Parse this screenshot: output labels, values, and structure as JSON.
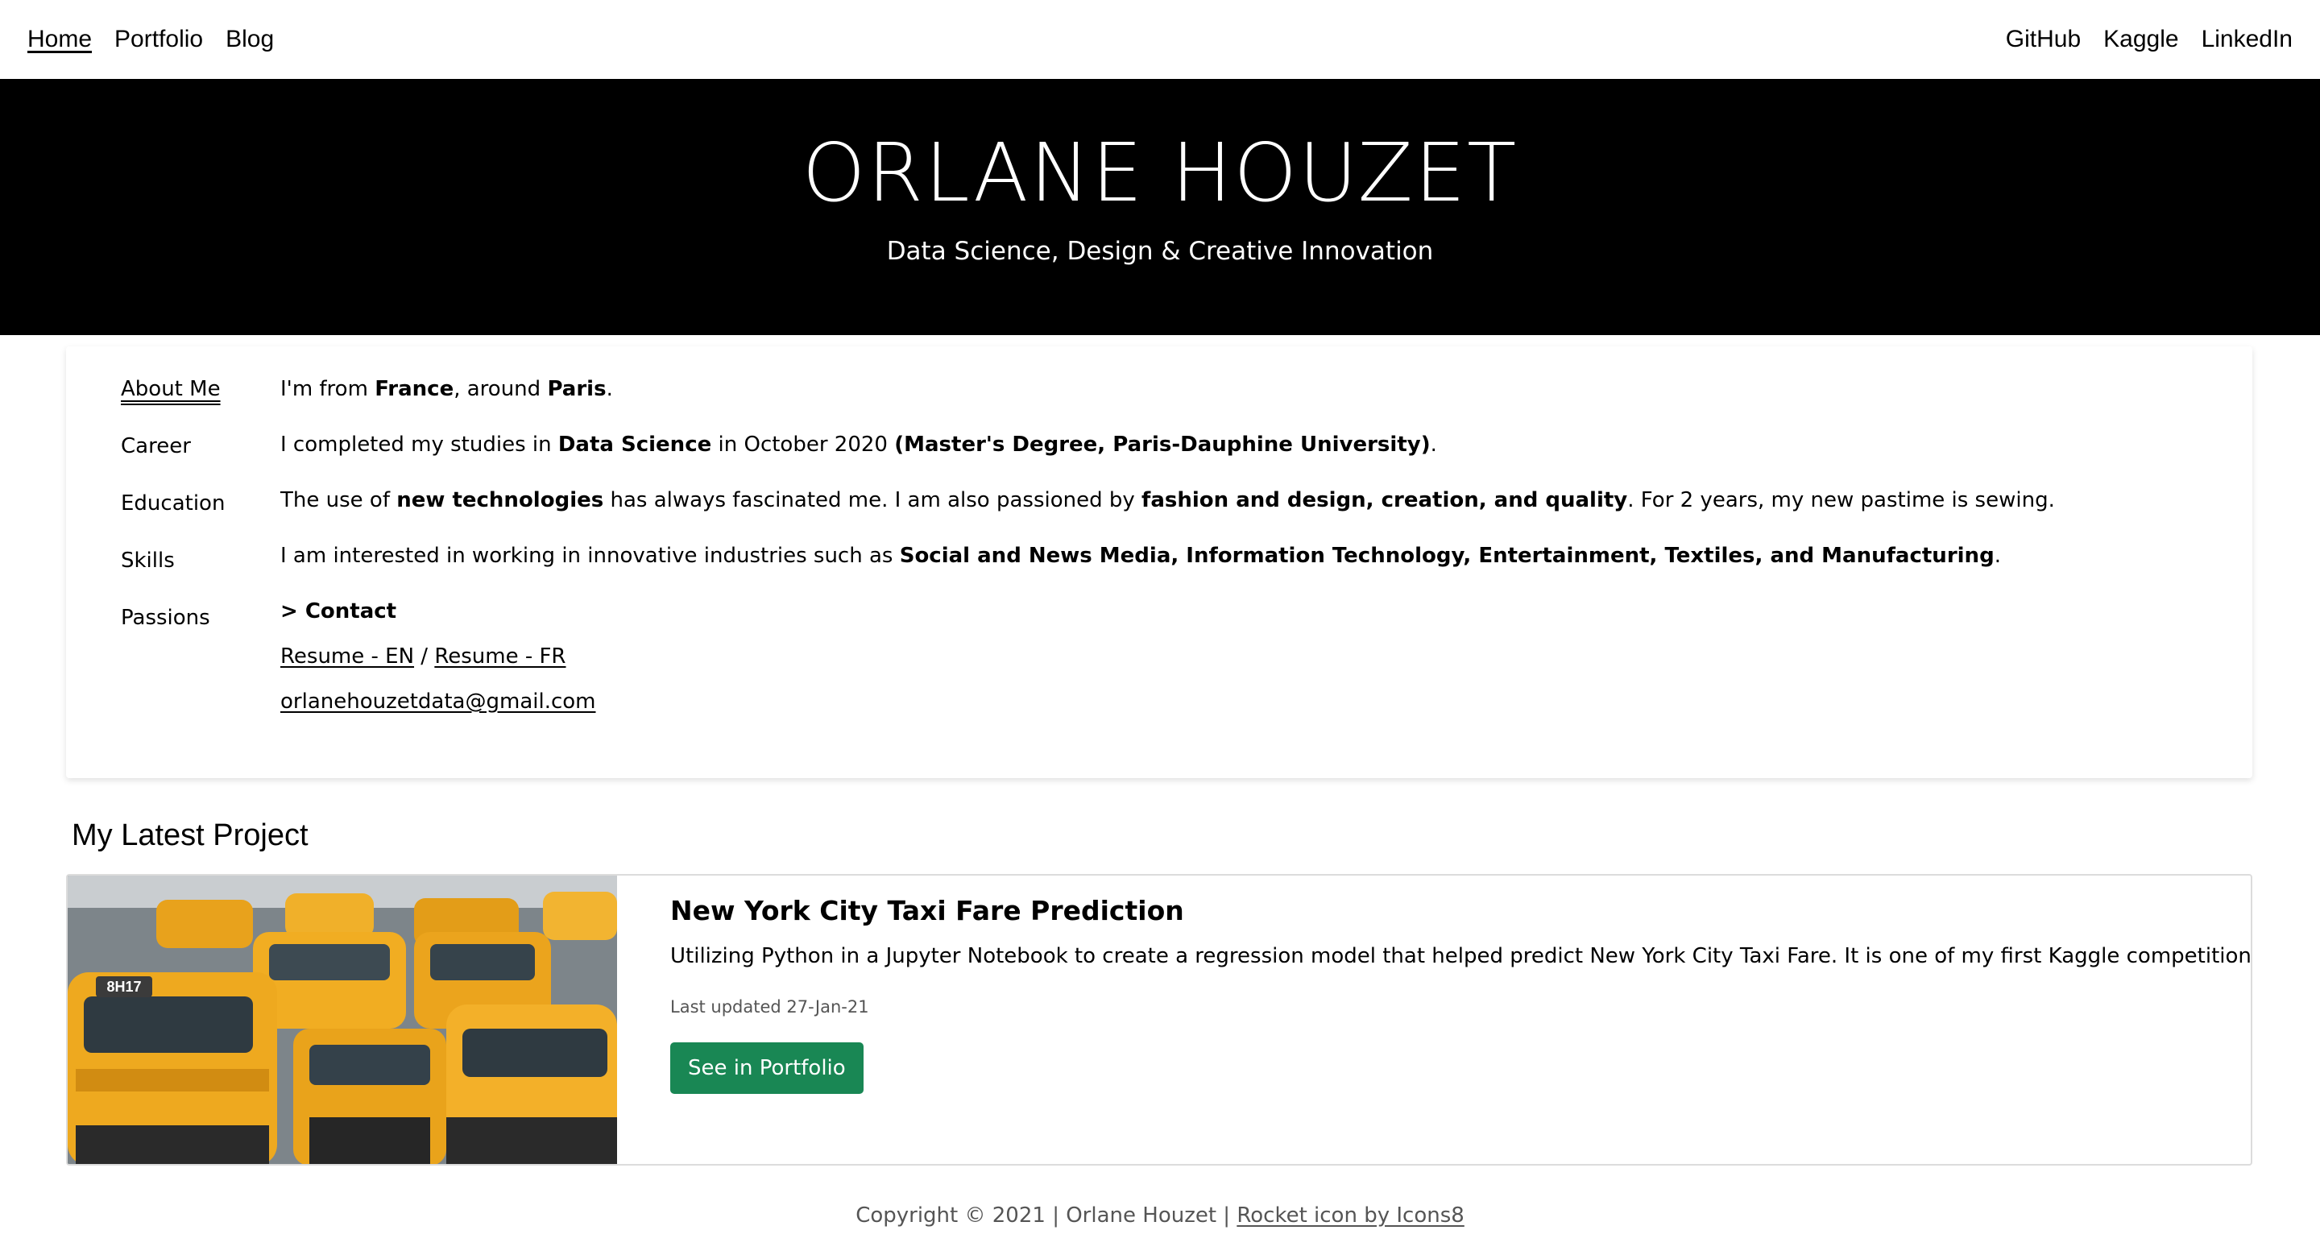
{
  "nav": {
    "home": "Home",
    "portfolio": "Portfolio",
    "blog": "Blog",
    "github": "GitHub",
    "kaggle": "Kaggle",
    "linkedin": "LinkedIn"
  },
  "hero": {
    "name": "ORLANE HOUZET",
    "subtitle": "Data Science, Design & Creative Innovation"
  },
  "about": {
    "tabs": [
      "About Me",
      "Career",
      "Education",
      "Skills",
      "Passions"
    ],
    "active_tab": "About Me",
    "line1": {
      "t1": "I'm from ",
      "b1": "France",
      "t2": ", around ",
      "b2": "Paris",
      "t3": "."
    },
    "line2": {
      "t1": "I completed my studies in ",
      "b1": "Data Science",
      "t2": " in October 2020 ",
      "b2": "(Master's Degree, Paris-Dauphine University)",
      "t3": "."
    },
    "line3": {
      "t1": "The use of ",
      "b1": "new technologies",
      "t2": " has always fascinated me. I am also passioned by ",
      "b2": "fashion and design, creation, and quality",
      "t3": ". For 2 years, my new pastime is sewing."
    },
    "line4": {
      "t1": "I am interested in working in innovative industries such as ",
      "b1": "Social and News Media, Information Technology, Entertainment, Textiles, and Manufacturing",
      "t2": "."
    },
    "contact_heading": "> Contact",
    "resume_en": "Resume - EN",
    "resume_separator": " / ",
    "resume_fr": "Resume - FR",
    "email": "orlanehouzetdata@gmail.com"
  },
  "latest_project": {
    "section_title": "My Latest Project",
    "title": "New York City Taxi Fare Prediction",
    "description": "Utilizing Python in a Jupyter Notebook to create a regression model that helped predict New York City Taxi Fare. It is one of my first Kaggle competitions.",
    "updated": "Last updated 27-Jan-21",
    "button_label": "See in Portfolio",
    "image_label": "8H17",
    "button_color": "#198754"
  },
  "footer": {
    "copyright": "Copyright © 2021 | Orlane Houzet | ",
    "credit_link": "Rocket icon by Icons8"
  }
}
